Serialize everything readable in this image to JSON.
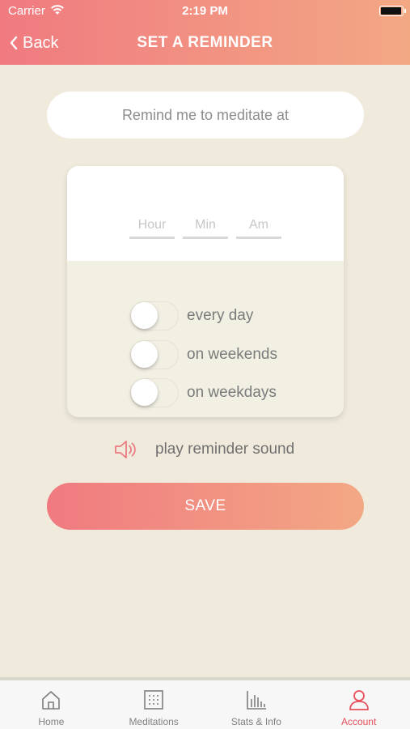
{
  "status": {
    "carrier": "Carrier",
    "time": "2:19 PM"
  },
  "header": {
    "back_label": "Back",
    "title": "SET A REMINDER"
  },
  "prompt": {
    "text": "Remind me to meditate at"
  },
  "time_picker": {
    "hour_placeholder": "Hour",
    "min_placeholder": "Min",
    "ampm_placeholder": "Am"
  },
  "schedule": {
    "options": [
      {
        "label": "every day",
        "on": false
      },
      {
        "label": "on weekends",
        "on": false
      },
      {
        "label": "on weekdays",
        "on": false
      }
    ]
  },
  "sound": {
    "label": "play reminder sound",
    "icon": "speaker-icon"
  },
  "save": {
    "label": "SAVE"
  },
  "tabs": [
    {
      "label": "Home",
      "icon": "home-icon",
      "active": false
    },
    {
      "label": "Meditations",
      "icon": "grid-icon",
      "active": false
    },
    {
      "label": "Stats & Info",
      "icon": "bar-chart-icon",
      "active": false
    },
    {
      "label": "Account",
      "icon": "user-icon",
      "active": true
    }
  ],
  "colors": {
    "accent_start": "#f07a80",
    "accent_end": "#f3a884",
    "background": "#efeadc",
    "active_tab": "#e8505b"
  }
}
